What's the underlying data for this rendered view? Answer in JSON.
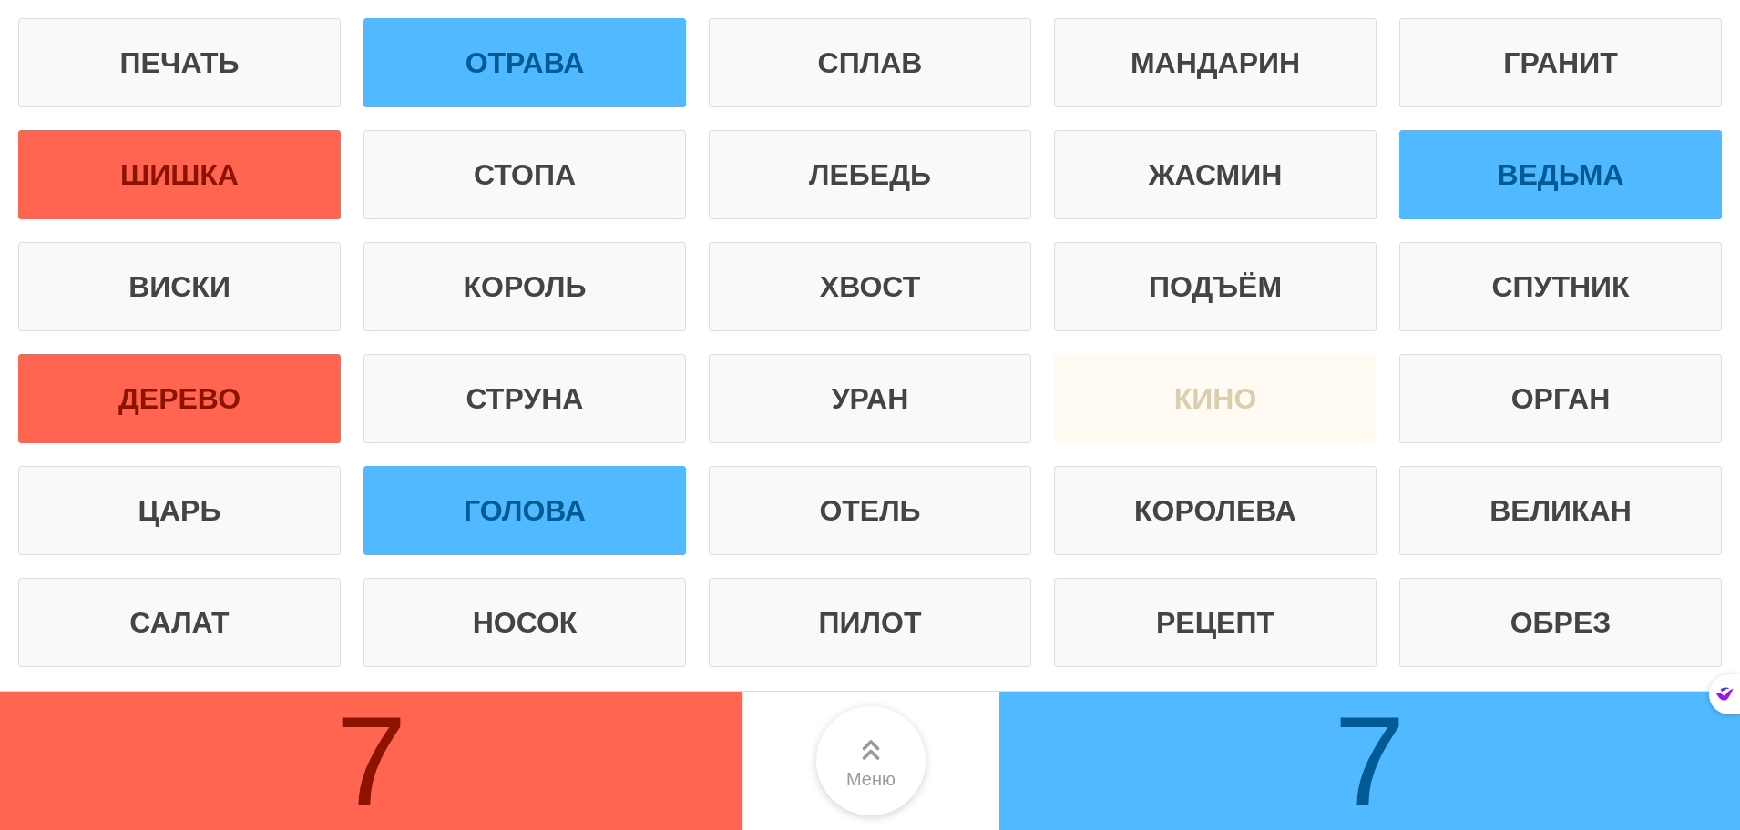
{
  "cards": [
    {
      "word": "ПЕЧАТЬ",
      "kind": "unrevealed"
    },
    {
      "word": "ОТРАВА",
      "kind": "blue"
    },
    {
      "word": "СПЛАВ",
      "kind": "unrevealed"
    },
    {
      "word": "МАНДАРИН",
      "kind": "unrevealed"
    },
    {
      "word": "ГРАНИТ",
      "kind": "unrevealed"
    },
    {
      "word": "ШИШКА",
      "kind": "red"
    },
    {
      "word": "СТОПА",
      "kind": "unrevealed"
    },
    {
      "word": "ЛЕБЕДЬ",
      "kind": "unrevealed"
    },
    {
      "word": "ЖАСМИН",
      "kind": "unrevealed"
    },
    {
      "word": "ВЕДЬМА",
      "kind": "blue"
    },
    {
      "word": "ВИСКИ",
      "kind": "unrevealed"
    },
    {
      "word": "КОРОЛЬ",
      "kind": "unrevealed"
    },
    {
      "word": "ХВОСТ",
      "kind": "unrevealed"
    },
    {
      "word": "ПОДЪЁМ",
      "kind": "unrevealed"
    },
    {
      "word": "СПУТНИК",
      "kind": "unrevealed"
    },
    {
      "word": "ДЕРЕВО",
      "kind": "red"
    },
    {
      "word": "СТРУНА",
      "kind": "unrevealed"
    },
    {
      "word": "УРАН",
      "kind": "unrevealed"
    },
    {
      "word": "КИНО",
      "kind": "neutral"
    },
    {
      "word": "ОРГАН",
      "kind": "unrevealed"
    },
    {
      "word": "ЦАРЬ",
      "kind": "unrevealed"
    },
    {
      "word": "ГОЛОВА",
      "kind": "blue"
    },
    {
      "word": "ОТЕЛЬ",
      "kind": "unrevealed"
    },
    {
      "word": "КОРОЛЕВА",
      "kind": "unrevealed"
    },
    {
      "word": "ВЕЛИКАН",
      "kind": "unrevealed"
    },
    {
      "word": "САЛАТ",
      "kind": "unrevealed"
    },
    {
      "word": "НОСОК",
      "kind": "unrevealed"
    },
    {
      "word": "ПИЛОТ",
      "kind": "unrevealed"
    },
    {
      "word": "РЕЦЕПТ",
      "kind": "unrevealed"
    },
    {
      "word": "ОБРЕЗ",
      "kind": "unrevealed"
    }
  ],
  "score_bar": {
    "red_score": "7",
    "menu_label": "Меню",
    "blue_score": "7"
  }
}
